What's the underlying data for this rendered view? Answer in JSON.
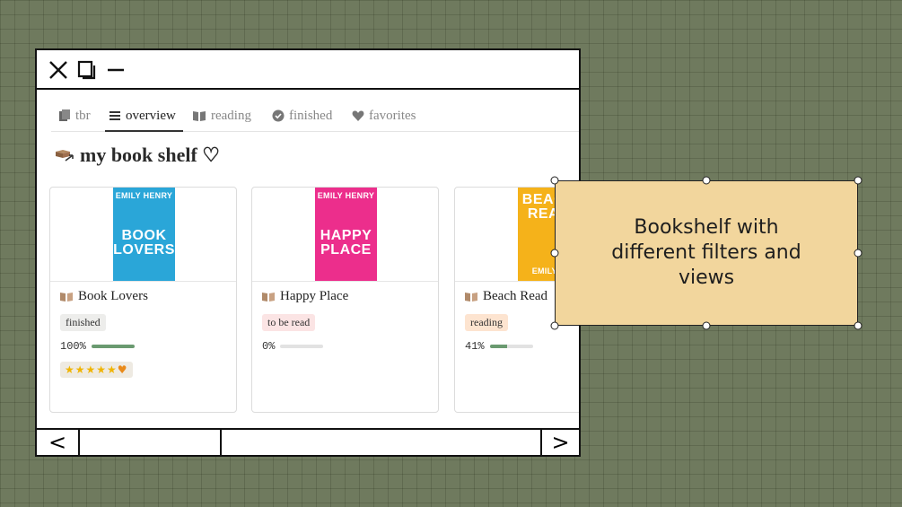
{
  "window": {
    "controls": {
      "close_icon": "close-icon",
      "restore_icon": "restore-icon",
      "minimize_icon": "minimize-icon"
    }
  },
  "tabs": [
    {
      "label": "tbr",
      "icon": "books-icon",
      "active": false
    },
    {
      "label": "overview",
      "icon": "list-icon",
      "active": true
    },
    {
      "label": "reading",
      "icon": "open-book-icon",
      "active": false
    },
    {
      "label": "finished",
      "icon": "check-circle-icon",
      "active": false
    },
    {
      "label": "favorites",
      "icon": "heart-icon",
      "active": false
    }
  ],
  "heading": {
    "text": "my book shelf ♡",
    "icon": "book-shelf-icon"
  },
  "books": [
    {
      "title": "Book Lovers",
      "cover_author": "EMILY HENRY",
      "cover_title": "BOOK LOVERS",
      "cover_color": "#2aa6d8",
      "status": "finished",
      "status_color": "#ededeb",
      "progress": "100%",
      "progress_fraction": 1.0,
      "rating": "★★★★★",
      "rating_extra": "♥"
    },
    {
      "title": "Happy Place",
      "cover_author": "EMILY HENRY",
      "cover_title": "HAPPY PLACE",
      "cover_color": "#ec2e8c",
      "status": "to be read",
      "status_color": "#fbe4e4",
      "progress": "0%",
      "progress_fraction": 0.0
    },
    {
      "title": "Beach Read",
      "cover_author": "EMILY H",
      "cover_title": "BEACH READ",
      "cover_color": "#f5b21a",
      "status": "reading",
      "status_color": "#fde4d0",
      "progress": "41%",
      "progress_fraction": 0.41
    }
  ],
  "footer": {
    "prev_label": "<",
    "next_label": ">"
  },
  "callout": {
    "text": "Bookshelf with different filters and views"
  },
  "colors": {
    "background": "#6f7a5e",
    "callout_bg": "#f2d69d",
    "progress_fill": "#6a9a70"
  }
}
